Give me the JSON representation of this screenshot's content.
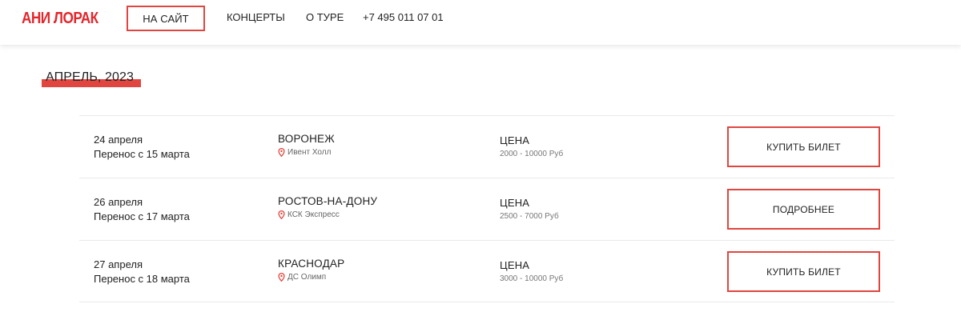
{
  "header": {
    "logo": "АНИ ЛОРАК",
    "nav": {
      "site": "НА САЙТ",
      "concerts": "КОНЦЕРТЫ",
      "about": "О ТУРЕ",
      "phone": "+7 495 011 07 01"
    }
  },
  "month": "АПРЕЛЬ, 2023",
  "events": [
    {
      "date": "24 апреля",
      "reschedule": "Перенос с 15 марта",
      "city": "ВОРОНЕЖ",
      "venue": "Ивент Холл",
      "price_label": "ЦЕНА",
      "price": "2000 - 10000 Руб",
      "button": "КУПИТЬ БИЛЕТ"
    },
    {
      "date": "26 апреля",
      "reschedule": "Перенос с 17 марта",
      "city": "РОСТОВ-НА-ДОНУ",
      "venue": "КСК Экспресс",
      "price_label": "ЦЕНА",
      "price": "2500 - 7000 Руб",
      "button": "ПОДРОБНЕЕ"
    },
    {
      "date": "27 апреля",
      "reschedule": "Перенос с 18 марта",
      "city": "КРАСНОДАР",
      "venue": "ДС Олимп",
      "price_label": "ЦЕНА",
      "price": "3000 - 10000 Руб",
      "button": "КУПИТЬ БИЛЕТ"
    }
  ],
  "colors": {
    "accent": "#e0463f",
    "logo": "#e3262b",
    "text": "#222222",
    "muted": "#777777"
  },
  "icons": {
    "venue": "location-pin-icon"
  }
}
